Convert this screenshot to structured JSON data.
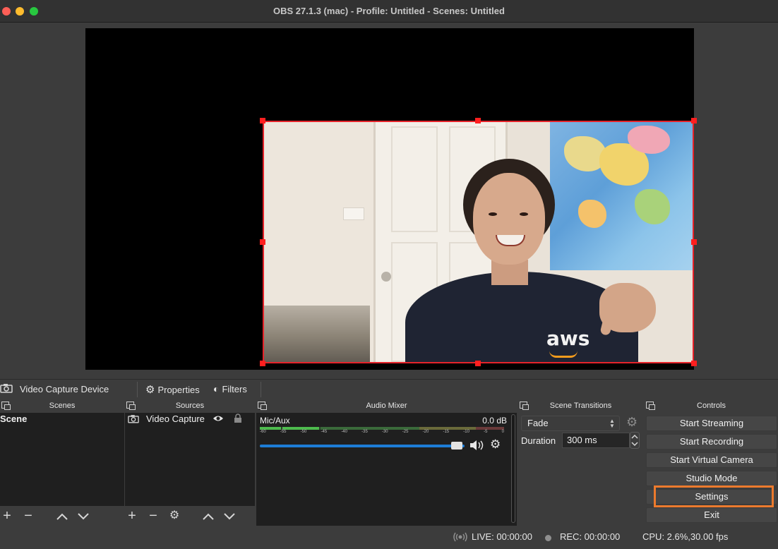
{
  "window": {
    "title": "OBS 27.1.3 (mac) - Profile: Untitled - Scenes: Untitled"
  },
  "source_toolbar": {
    "source_name": "Video Capture Device",
    "properties_label": "Properties",
    "filters_label": "Filters"
  },
  "scenes": {
    "header": "Scenes",
    "items": [
      "Scene"
    ]
  },
  "sources": {
    "header": "Sources",
    "items": [
      "Video Capture"
    ]
  },
  "audio_mixer": {
    "header": "Audio Mixer",
    "channel_name": "Mic/Aux",
    "level": "0.0 dB",
    "meter_ticks": [
      "-60",
      "-55",
      "-50",
      "-45",
      "-40",
      "-35",
      "-30",
      "-25",
      "-20",
      "-15",
      "-10",
      "-5",
      "0"
    ],
    "volume_fraction": 0.97
  },
  "scene_transitions": {
    "header": "Scene Transitions",
    "transition": "Fade",
    "duration_label": "Duration",
    "duration_value": "300 ms"
  },
  "controls": {
    "header": "Controls",
    "start_streaming": "Start Streaming",
    "start_recording": "Start Recording",
    "start_virtual_camera": "Start Virtual Camera",
    "studio_mode": "Studio Mode",
    "settings": "Settings",
    "exit": "Exit"
  },
  "status": {
    "live": "LIVE: 00:00:00",
    "rec": "REC: 00:00:00",
    "cpu": "CPU: 2.6%,30.00 fps"
  },
  "colors": {
    "selection_border": "#e5232a",
    "highlight": "#ec7a2d",
    "volume_slider": "#1d7cd6"
  },
  "icons": [
    "camera-icon",
    "gear-icon",
    "filters-icon",
    "plus-icon",
    "minus-icon",
    "chevron-up-icon",
    "chevron-down-icon",
    "eye-icon",
    "lock-icon",
    "speaker-icon",
    "live-icon"
  ]
}
